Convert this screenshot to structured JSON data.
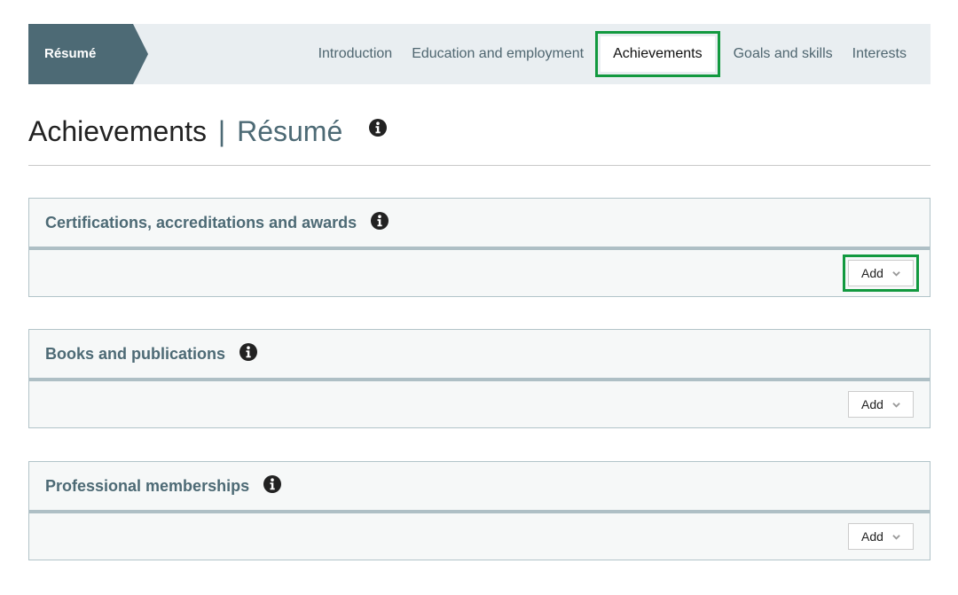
{
  "nav": {
    "brand": "Résumé",
    "tabs": [
      {
        "label": "Introduction",
        "active": false
      },
      {
        "label": "Education and employment",
        "active": false
      },
      {
        "label": "Achievements",
        "active": true
      },
      {
        "label": "Goals and skills",
        "active": false
      },
      {
        "label": "Interests",
        "active": false
      }
    ]
  },
  "page": {
    "title": "Achievements",
    "separator": "|",
    "subtitle": "Résumé",
    "info_icon": "info-circle-icon"
  },
  "sections": [
    {
      "title": "Certifications, accreditations and awards",
      "info_icon": "info-circle-icon",
      "add_label": "Add",
      "add_icon": "chevron-down-icon"
    },
    {
      "title": "Books and publications",
      "info_icon": "info-circle-icon",
      "add_label": "Add",
      "add_icon": "chevron-down-icon"
    },
    {
      "title": "Professional memberships",
      "info_icon": "info-circle-icon",
      "add_label": "Add",
      "add_icon": "chevron-down-icon"
    }
  ],
  "colors": {
    "brand": "#4d6a75",
    "nav_bg": "#e9eef1",
    "highlight": "#12993f",
    "section_bg": "#f6f8f8"
  }
}
